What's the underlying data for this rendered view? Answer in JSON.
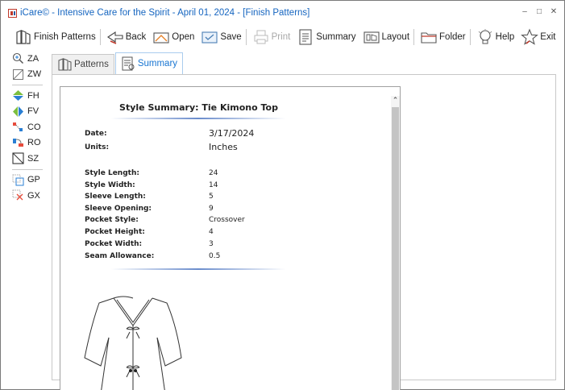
{
  "window": {
    "title": "iCare© - Intensive Care for the Spirit - April 01, 2024 - [Finish Patterns]",
    "controls": {
      "minimize": "–",
      "restore": "□",
      "close": "✕"
    }
  },
  "toolbar": {
    "finish_patterns": "Finish Patterns",
    "back": "Back",
    "open": "Open",
    "save": "Save",
    "print": "Print",
    "summary": "Summary",
    "layout": "Layout",
    "folder": "Folder",
    "help": "Help",
    "exit": "Exit"
  },
  "left_tools": [
    {
      "label": "ZA",
      "icon": "zoom-all-icon"
    },
    {
      "label": "ZW",
      "icon": "zoom-window-icon"
    },
    {
      "label": "FH",
      "icon": "flip-horizontal-icon"
    },
    {
      "label": "FV",
      "icon": "flip-vertical-icon"
    },
    {
      "label": "CO",
      "icon": "copy-icon"
    },
    {
      "label": "RO",
      "icon": "rotate-icon"
    },
    {
      "label": "SZ",
      "icon": "size-icon"
    },
    {
      "label": "GP",
      "icon": "group-pieces-icon"
    },
    {
      "label": "GX",
      "icon": "ungroup-icon"
    }
  ],
  "tabs": [
    {
      "label": "Patterns",
      "active": false
    },
    {
      "label": "Summary",
      "active": true
    }
  ],
  "summary": {
    "title": "Style Summary: Tie Kimono Top",
    "date_label": "Date:",
    "date_value": "3/17/2024",
    "units_label": "Units:",
    "units_value": "Inches",
    "fields": [
      {
        "label": "Style Length:",
        "value": "24"
      },
      {
        "label": "Style Width:",
        "value": "14"
      },
      {
        "label": "Sleeve Length:",
        "value": "5"
      },
      {
        "label": "Sleeve Opening:",
        "value": "9"
      },
      {
        "label": "Pocket Style:",
        "value": "Crossover"
      },
      {
        "label": "Pocket Height:",
        "value": "4"
      },
      {
        "label": "Pocket Width:",
        "value": "3"
      },
      {
        "label": "Seam Allowance:",
        "value": "0.5"
      }
    ]
  },
  "colors": {
    "accent": "#1976d2",
    "title": "#1565c0",
    "rule": "#6a8ccc"
  }
}
